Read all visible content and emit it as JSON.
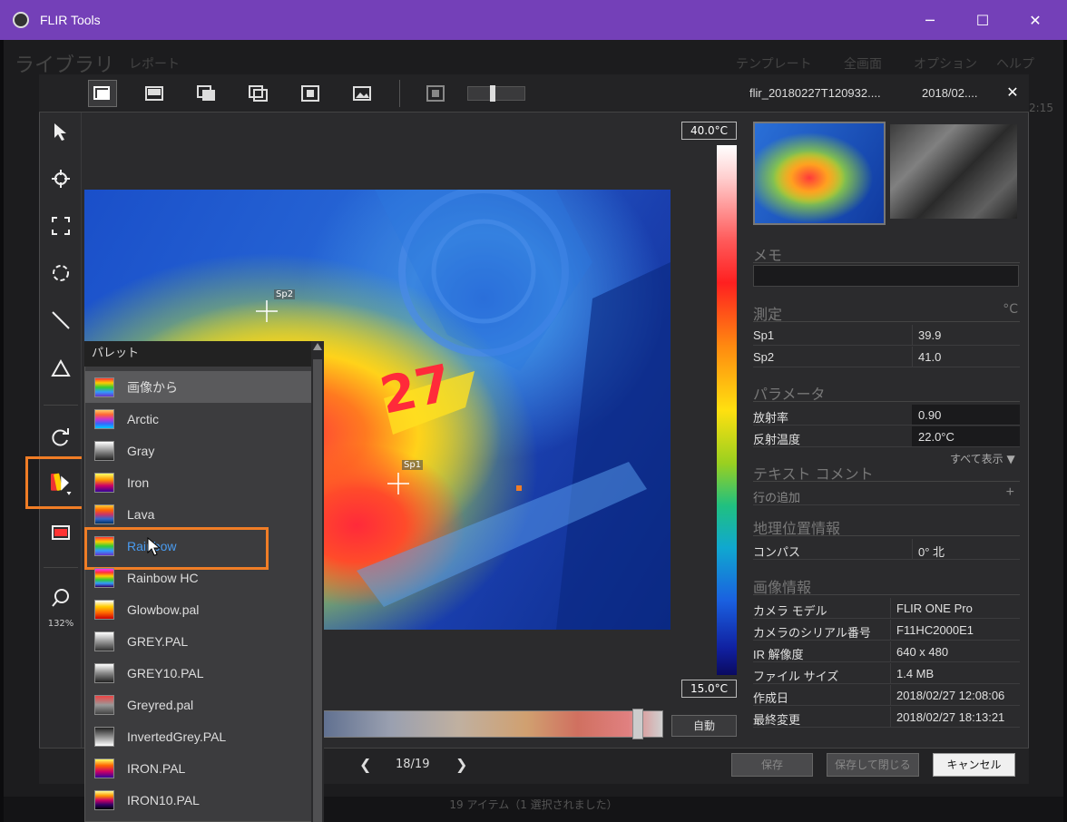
{
  "window": {
    "title": "FLIR Tools",
    "minimize": "─",
    "maximize": "☐",
    "close": "✕"
  },
  "background_app": {
    "menu": [
      "ライブラリ",
      "レポート",
      "テンプレート",
      "全画面",
      "オプション",
      "ヘルプ"
    ],
    "time": "2:15",
    "status": "19 アイテム（1 選択されました）"
  },
  "dialog": {
    "filename": "flir_20180227T120932....",
    "date": "2018/02....",
    "close": "✕",
    "toolbar_icons": [
      "single-view-icon",
      "thermal-view-icon",
      "overlay-view-icon",
      "pip-view-icon",
      "msx-view-icon",
      "visual-view-icon",
      "fit-icon"
    ]
  },
  "tools": {
    "icons": [
      "pointer-icon",
      "spot-icon",
      "box-icon",
      "circle-icon",
      "line-icon",
      "delta-icon",
      "rotate-icon",
      "palette-icon",
      "scale-icon",
      "zoom-icon"
    ],
    "zoom": "132%"
  },
  "image": {
    "temp_max": "40.0°C",
    "temp_min": "15.0°C",
    "spots": [
      {
        "label": "Sp2"
      },
      {
        "label": "Sp1"
      }
    ],
    "auto": "自動"
  },
  "navigation": {
    "prev": "❮",
    "count": "18/19",
    "next": "❯"
  },
  "buttons": {
    "save": "保存",
    "save_close": "保存して閉じる",
    "cancel": "キャンセル"
  },
  "panel": {
    "memo_label": "メモ",
    "measure_label": "測定",
    "measure_unit": "°C",
    "measurements": [
      {
        "k": "Sp1",
        "v": "39.9"
      },
      {
        "k": "Sp2",
        "v": "41.0"
      }
    ],
    "params_label": "パラメータ",
    "params": [
      {
        "k": "放射率",
        "v": "0.90"
      },
      {
        "k": "反射温度",
        "v": "22.0°C"
      }
    ],
    "show_all": "すべて表示 ▼",
    "text_comment_label": "テキスト コメント",
    "add_row": "行の追加",
    "add_row_plus": "+",
    "geo_label": "地理位置情報",
    "geo": [
      {
        "k": "コンパス",
        "v": "0° 北"
      }
    ],
    "image_info_label": "画像情報",
    "image_info": [
      {
        "k": "カメラ モデル",
        "v": "FLIR ONE Pro"
      },
      {
        "k": "カメラのシリアル番号",
        "v": "F11HC2000E1"
      },
      {
        "k": "IR 解像度",
        "v": "640 x 480"
      },
      {
        "k": "ファイル サイズ",
        "v": "1.4 MB"
      },
      {
        "k": "作成日",
        "v": "2018/02/27 12:08:06"
      },
      {
        "k": "最終変更",
        "v": "2018/02/27 18:13:21"
      }
    ]
  },
  "palette": {
    "header": "パレット",
    "items": [
      "画像から",
      "Arctic",
      "Gray",
      "Iron",
      "Lava",
      "Rainbow",
      "Rainbow HC",
      "Glowbow.pal",
      "GREY.PAL",
      "GREY10.PAL",
      "Greyred.pal",
      "InvertedGrey.PAL",
      "IRON.PAL",
      "IRON10.PAL"
    ],
    "selected": "Rainbow",
    "highlight_color": "#f07d26",
    "hover_text_color": "#4a9cf0"
  }
}
